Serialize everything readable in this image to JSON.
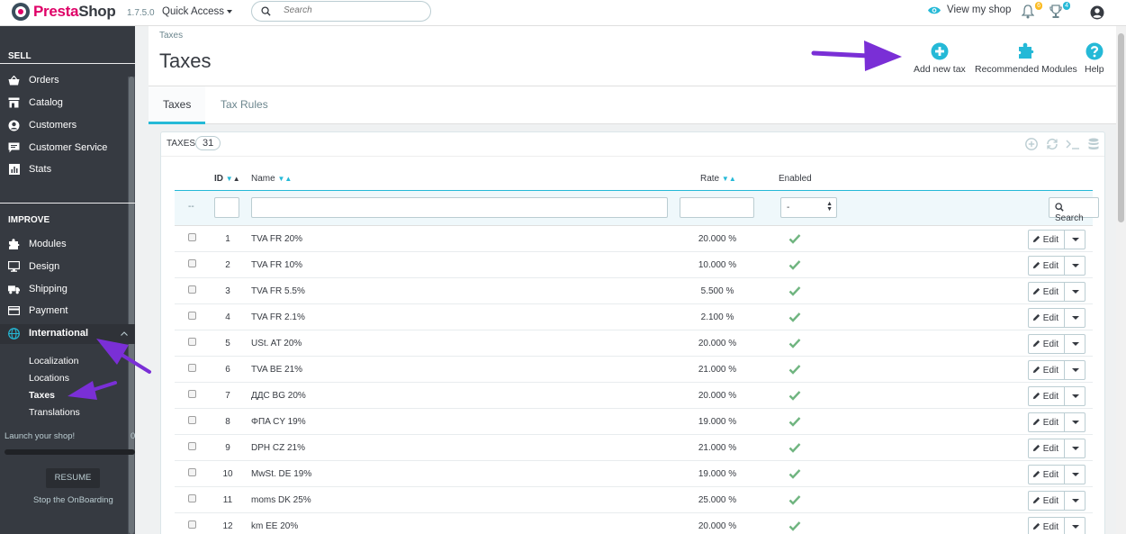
{
  "header": {
    "brand_a": "Presta",
    "brand_b": "Shop",
    "version": "1.7.5.0",
    "quick_access": "Quick Access",
    "search_placeholder": "Search",
    "view_shop": "View my shop",
    "notif_orders": "6",
    "notif_customers": "4"
  },
  "sidebar": {
    "sell_heading": "SELL",
    "sell_items": [
      "Orders",
      "Catalog",
      "Customers",
      "Customer Service",
      "Stats"
    ],
    "improve_heading": "IMPROVE",
    "improve_items": [
      "Modules",
      "Design",
      "Shipping",
      "Payment",
      "International"
    ],
    "sub_items": [
      "Localization",
      "Locations",
      "Taxes",
      "Translations"
    ],
    "launch": "Launch your shop!",
    "launch_count": "0",
    "resume": "RESUME",
    "stop": "Stop the OnBoarding"
  },
  "page": {
    "breadcrumb": "Taxes",
    "title": "Taxes",
    "toolbar": {
      "add": "Add new tax",
      "modules": "Recommended Modules",
      "help": "Help"
    },
    "tabs": [
      "Taxes",
      "Tax Rules"
    ]
  },
  "panel": {
    "title": "Taxes",
    "count": "31",
    "columns": {
      "id": "ID",
      "name": "Name",
      "rate": "Rate",
      "enabled": "Enabled"
    },
    "filter_dash": "--",
    "filter_select": "-",
    "search_button": "Search",
    "edit_label": "Edit",
    "rows": [
      {
        "id": "1",
        "name": "TVA FR 20%",
        "rate": "20.000 %"
      },
      {
        "id": "2",
        "name": "TVA FR 10%",
        "rate": "10.000 %"
      },
      {
        "id": "3",
        "name": "TVA FR 5.5%",
        "rate": "5.500 %"
      },
      {
        "id": "4",
        "name": "TVA FR 2.1%",
        "rate": "2.100 %"
      },
      {
        "id": "5",
        "name": "USt. AT 20%",
        "rate": "20.000 %"
      },
      {
        "id": "6",
        "name": "TVA BE 21%",
        "rate": "21.000 %"
      },
      {
        "id": "7",
        "name": "ДДС BG 20%",
        "rate": "20.000 %"
      },
      {
        "id": "8",
        "name": "ΦΠΑ CY 19%",
        "rate": "19.000 %"
      },
      {
        "id": "9",
        "name": "DPH CZ 21%",
        "rate": "21.000 %"
      },
      {
        "id": "10",
        "name": "MwSt. DE 19%",
        "rate": "19.000 %"
      },
      {
        "id": "11",
        "name": "moms DK 25%",
        "rate": "25.000 %"
      },
      {
        "id": "12",
        "name": "km EE 20%",
        "rate": "20.000 %"
      }
    ]
  },
  "colors": {
    "accent": "#25b9d7",
    "brand": "#df0067",
    "success": "#70b580",
    "annotation": "#7a2fd6"
  }
}
